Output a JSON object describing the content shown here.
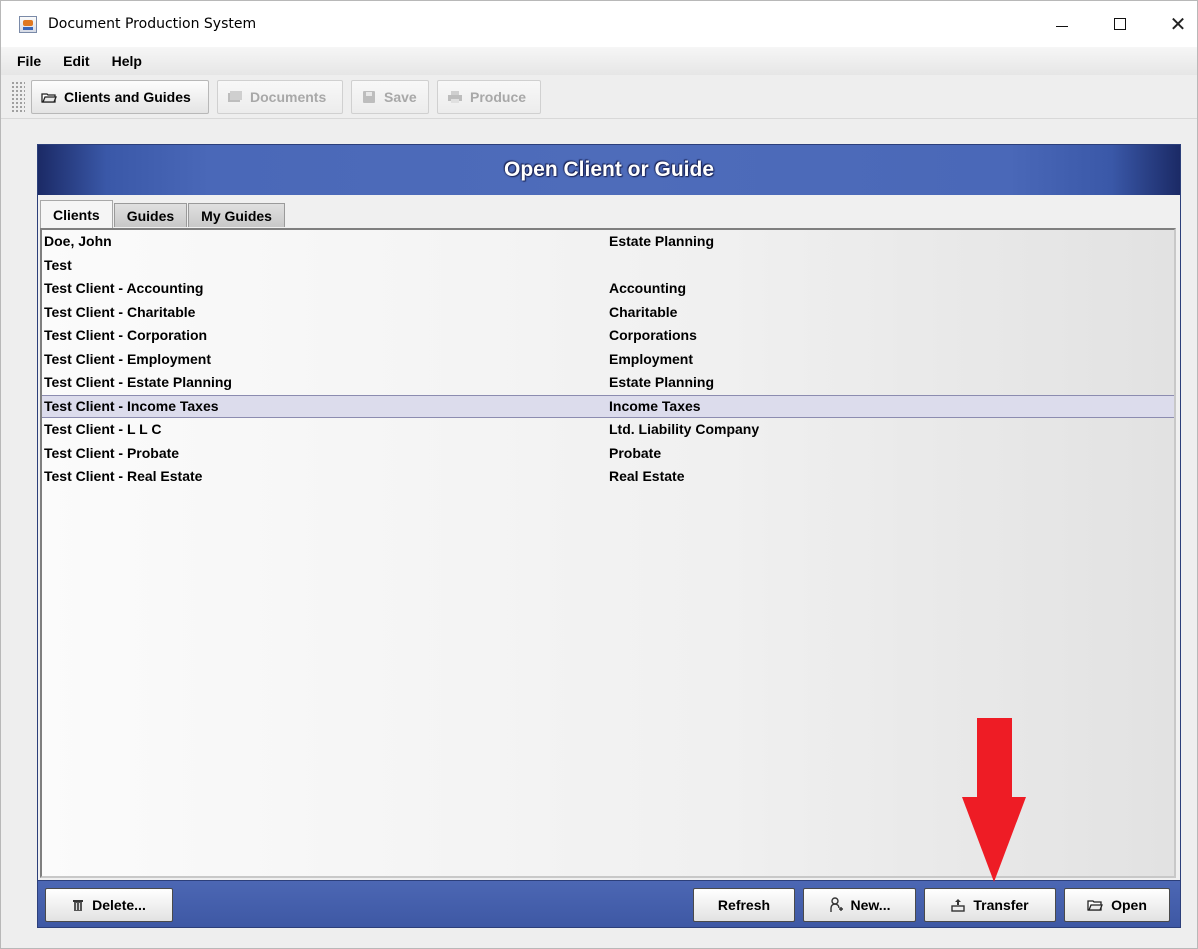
{
  "window": {
    "title": "Document Production System",
    "controls": {
      "minimize": "minimize",
      "maximize": "maximize",
      "close": "close"
    }
  },
  "menu": [
    "File",
    "Edit",
    "Help"
  ],
  "toolbar": {
    "clients_and_guides": "Clients and Guides",
    "documents": "Documents",
    "save": "Save",
    "produce": "Produce"
  },
  "panel": {
    "title": "Open Client or Guide",
    "tabs": [
      "Clients",
      "Guides",
      "My Guides"
    ],
    "active_tab": "Clients",
    "rows": [
      {
        "name": "Doe, John",
        "type": "Estate Planning"
      },
      {
        "name": "Test",
        "type": ""
      },
      {
        "name": "Test Client - Accounting",
        "type": "Accounting"
      },
      {
        "name": "Test Client - Charitable",
        "type": "Charitable"
      },
      {
        "name": "Test Client - Corporation",
        "type": "Corporations"
      },
      {
        "name": "Test Client - Employment",
        "type": "Employment"
      },
      {
        "name": "Test Client - Estate Planning",
        "type": "Estate Planning"
      },
      {
        "name": "Test Client - Income Taxes",
        "type": "Income Taxes"
      },
      {
        "name": "Test Client - L L C",
        "type": "Ltd. Liability Company"
      },
      {
        "name": "Test Client - Probate",
        "type": "Probate"
      },
      {
        "name": "Test Client - Real Estate",
        "type": "Real Estate"
      }
    ],
    "selected_row": "Test Client - Income Taxes"
  },
  "buttons": {
    "delete": "Delete...",
    "refresh": "Refresh",
    "new": "New...",
    "transfer": "Transfer",
    "open": "Open"
  },
  "colors": {
    "header_blue": "#4e6cba",
    "header_dark": "#1b2a66",
    "selection": "#dcdcec",
    "arrow": "#ee1c25"
  },
  "icons": {
    "app": "app-icon",
    "clients_guides": "folder-open-icon",
    "documents": "documents-icon",
    "save": "save-icon",
    "produce": "printer-icon",
    "delete": "trash-icon",
    "new": "new-user-icon",
    "transfer": "transfer-icon",
    "open": "open-folder-icon"
  }
}
